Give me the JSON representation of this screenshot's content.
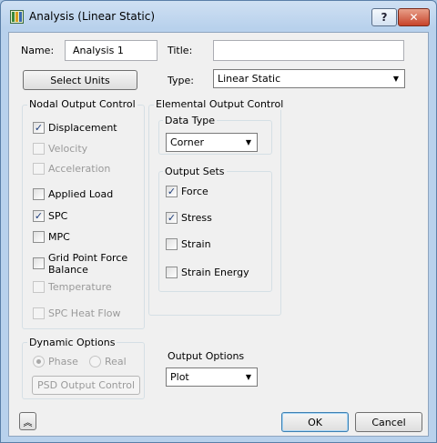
{
  "window": {
    "title": "Analysis (Linear Static)",
    "help_glyph": "?",
    "close_glyph": "✕"
  },
  "form": {
    "name_label": "Name:",
    "name_value": "Analysis 1",
    "title_label": "Title:",
    "title_value": "",
    "select_units_label": "Select Units",
    "type_label": "Type:",
    "type_value": "Linear Static"
  },
  "nodal": {
    "title": "Nodal Output Control",
    "items": [
      {
        "label": "Displacement",
        "checked": true,
        "enabled": true
      },
      {
        "label": "Velocity",
        "checked": false,
        "enabled": false
      },
      {
        "label": "Acceleration",
        "checked": false,
        "enabled": false
      },
      {
        "label": "Applied Load",
        "checked": false,
        "enabled": true
      },
      {
        "label": "SPC",
        "checked": true,
        "enabled": true
      },
      {
        "label": "MPC",
        "checked": false,
        "enabled": true
      },
      {
        "label": "Grid Point Force Balance",
        "checked": false,
        "enabled": true
      },
      {
        "label": "Temperature",
        "checked": false,
        "enabled": false
      },
      {
        "label": "SPC Heat Flow",
        "checked": false,
        "enabled": false
      }
    ]
  },
  "elemental": {
    "title": "Elemental Output Control",
    "data_type_title": "Data Type",
    "data_type_value": "Corner",
    "output_sets_title": "Output Sets",
    "items": [
      {
        "label": "Force",
        "checked": true
      },
      {
        "label": "Stress",
        "checked": true
      },
      {
        "label": "Strain",
        "checked": false
      },
      {
        "label": "Strain Energy",
        "checked": false
      }
    ]
  },
  "dynamic": {
    "title": "Dynamic Options",
    "phase_label": "Phase",
    "real_label": "Real",
    "psd_label": "PSD Output Control"
  },
  "output_options": {
    "title": "Output Options",
    "value": "Plot"
  },
  "footer": {
    "expand_glyph": "︽",
    "ok_label": "OK",
    "cancel_label": "Cancel"
  },
  "glyphs": {
    "check": "✓",
    "dropdown": "▼"
  }
}
